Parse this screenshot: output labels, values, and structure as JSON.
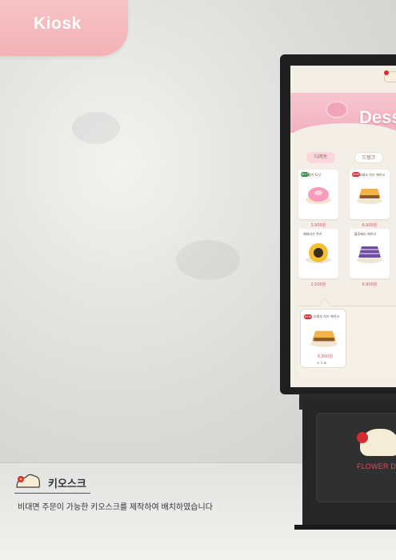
{
  "tab": {
    "label": "Kiosk"
  },
  "screen": {
    "banner_text": "Dess",
    "tabs": [
      "디저트",
      "드링크"
    ],
    "menu": [
      {
        "name": "딸기 도넛",
        "badge": "BEST",
        "price": "3,900원"
      },
      {
        "name": "오레오 치즈 케이크",
        "badge": "NEW",
        "price": "6,900원"
      },
      {
        "name": "해바라기 쿠키",
        "badge": "",
        "price": "2,500원"
      },
      {
        "name": "블루베리 케이크",
        "badge": "",
        "price": "6,900원"
      }
    ],
    "cart": {
      "name": "오레오 치즈 케이크",
      "badge": "NEW",
      "price": "6,900원",
      "qty": "1"
    }
  },
  "base": {
    "brand": "FLOWER DE"
  },
  "caption": {
    "title": "키오스크",
    "description": "비대면 주문이 가능한 키오스크를 제작하여 배치하였습니다"
  },
  "colors": {
    "accent": "#f4b2b6",
    "brand_red": "#d62b33",
    "kiosk_body": "#1f1f1f"
  }
}
